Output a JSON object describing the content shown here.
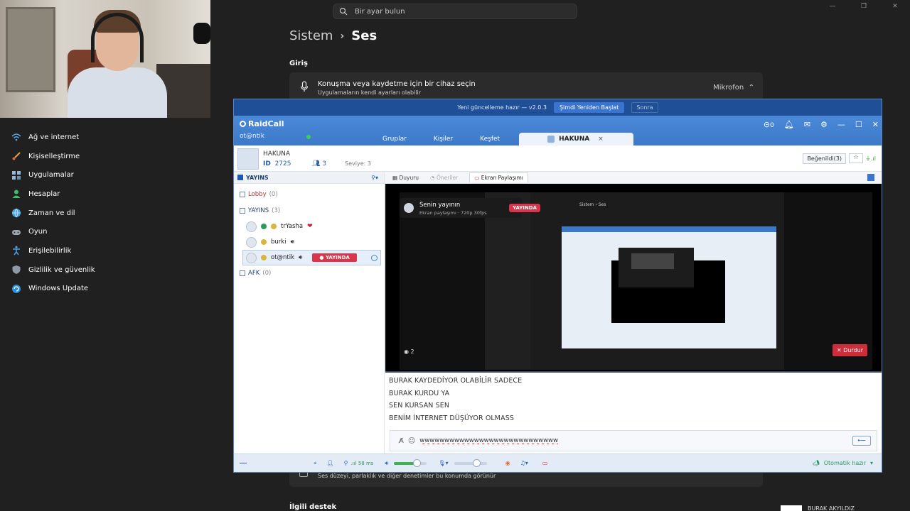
{
  "settings": {
    "search_placeholder": "Bir ayar bulun",
    "breadcrumb_parent": "Sistem",
    "breadcrumb_sep": "›",
    "breadcrumb_current": "Ses",
    "section_input": "Giriş",
    "input_title": "Konuşma veya kaydetme için bir cihaz seçin",
    "input_subtitle": "Uygulamaların kendi ayarları olabilir",
    "input_value": "Mikrofon",
    "lower_text": "Ses düzeyi, parlaklık ve diğer denetimler bu konumda görünür",
    "section_related": "İlgili destek",
    "nav": [
      {
        "label": "Ağ ve internet",
        "icon": "wifi-icon"
      },
      {
        "label": "Kişiselleştirme",
        "icon": "brush-icon"
      },
      {
        "label": "Uygulamalar",
        "icon": "apps-icon"
      },
      {
        "label": "Hesaplar",
        "icon": "account-icon"
      },
      {
        "label": "Zaman ve dil",
        "icon": "globe-clock-icon"
      },
      {
        "label": "Oyun",
        "icon": "gamepad-icon"
      },
      {
        "label": "Erişilebilirlik",
        "icon": "accessibility-icon"
      },
      {
        "label": "Gizlilik ve güvenlik",
        "icon": "shield-icon"
      },
      {
        "label": "Windows Update",
        "icon": "update-icon"
      }
    ],
    "streamer_name": "BURAK AKYILDIZ"
  },
  "raidcall": {
    "update_text": "Yeni güncelleme hazır — v2.0.3",
    "update_now": "Şimdi Yeniden Başlat",
    "update_later": "Sonra",
    "logo": "RaidCall",
    "user": "ot@ntik",
    "tabs": [
      "Gruplar",
      "Kişiler",
      "Keşfet"
    ],
    "active_tab": "HAKUNA",
    "tab_close": "×",
    "badge_count": "0",
    "group": {
      "name": "HAKUNA",
      "id_label": "ID",
      "id": "2725",
      "members": "3",
      "level": "Seviye: 3",
      "fav": "Beğenildi(3)"
    },
    "channels_head": "YAYINS",
    "lobby": {
      "name": "Lobby",
      "count": "(0)"
    },
    "yayins": {
      "name": "YAYINS",
      "count": "(3)"
    },
    "members": [
      {
        "name": "trYasha"
      },
      {
        "name": "burki"
      },
      {
        "name": "ot@ntik",
        "badge": "● YAYINDA"
      }
    ],
    "afk": {
      "name": "AFK",
      "count": "(0)"
    },
    "subtabs": {
      "announce": "Duyuru",
      "suggestions": "Öneriler",
      "screen": "Ekran Paylaşımı"
    },
    "stream": {
      "title": "Senin yayının",
      "subtitle": "Ekran paylaşımı · 720p 30fps",
      "live": "YAYINDA",
      "viewers": "2",
      "stop": "✕ Durdur",
      "inner_crumb": "Sistem › Ses"
    },
    "chat": [
      "BURAK KAYDEDİYOR OLABİLİR SADECE",
      "BURAK KURDU YA",
      "SEN KURSAN SEN",
      "BENİM İNTERNET DÜŞÜYOR OLMASS"
    ],
    "chat_input_value": "wwwwwwwwwwwwwwwwwwwwwwwwwwww",
    "send": "⟵",
    "ping": ".ııl 58 ms",
    "auto_ready": "Otomatik hazır",
    "mic_level": 0.75,
    "volume_level": 0.75
  }
}
